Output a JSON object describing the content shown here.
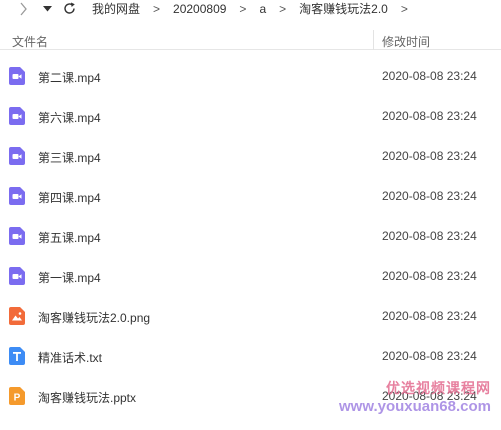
{
  "breadcrumb": [
    "我的网盘",
    "20200809",
    "a",
    "淘客赚钱玩法2.0"
  ],
  "columns": {
    "name": "文件名",
    "modified": "修改时间"
  },
  "files": [
    {
      "name": "第二课.mp4",
      "time": "2020-08-08 23:24",
      "type": "video",
      "color": "#7b6cf0"
    },
    {
      "name": "第六课.mp4",
      "time": "2020-08-08 23:24",
      "type": "video",
      "color": "#7b6cf0"
    },
    {
      "name": "第三课.mp4",
      "time": "2020-08-08 23:24",
      "type": "video",
      "color": "#7b6cf0"
    },
    {
      "name": "第四课.mp4",
      "time": "2020-08-08 23:24",
      "type": "video",
      "color": "#7b6cf0"
    },
    {
      "name": "第五课.mp4",
      "time": "2020-08-08 23:24",
      "type": "video",
      "color": "#7b6cf0"
    },
    {
      "name": "第一课.mp4",
      "time": "2020-08-08 23:24",
      "type": "video",
      "color": "#7b6cf0"
    },
    {
      "name": "淘客赚钱玩法2.0.png",
      "time": "2020-08-08 23:24",
      "type": "image",
      "color": "#f26b3a"
    },
    {
      "name": "精准话术.txt",
      "time": "2020-08-08 23:24",
      "type": "text",
      "color": "#3d8cf5"
    },
    {
      "name": "淘客赚钱玩法.pptx",
      "time": "2020-08-08 23:24",
      "type": "ppt",
      "color": "#f59a2c"
    }
  ],
  "watermark": {
    "text": "优选视频课程网",
    "url": "www.youxuan68.com"
  }
}
